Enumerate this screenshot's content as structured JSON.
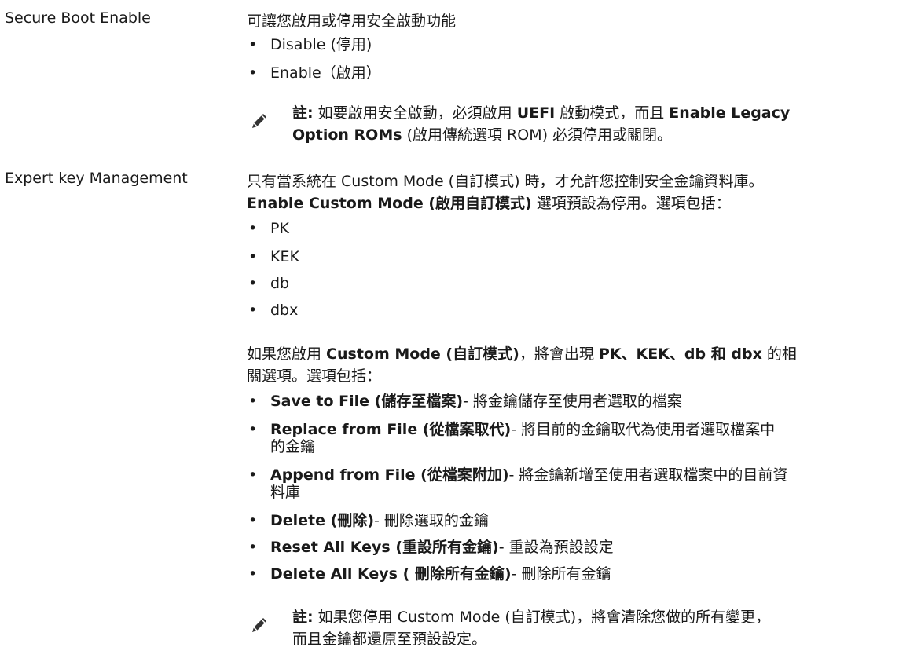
{
  "secure_boot": {
    "label": "Secure Boot Enable",
    "description": "可讓您啟用或停用安全啟動功能",
    "options": [
      "Disable (停用)",
      "Enable（啟用）"
    ],
    "note": {
      "prefix": "註:",
      "t1": " 如要啟用安全啟動，必須啟用 ",
      "b1": "UEFI",
      "t2": " 啟動模式，而且 ",
      "b2": "Enable Legacy",
      "b3": "Option ROMs",
      "t3": " (啟用傳統選項 ROM) 必須停用或關閉。"
    }
  },
  "expert_key": {
    "label": "Expert key Management",
    "desc_line1": "只有當系統在 Custom Mode (自訂模式) 時，才允許您控制安全金鑰資料庫。",
    "desc_line2_bold": "Enable Custom Mode (啟用自訂模式)",
    "desc_line2_rest": " 選項預設為停用。選項包括：",
    "keys": [
      "PK",
      "KEK",
      "db",
      "dbx"
    ],
    "custom_p1": "如果您啟用 ",
    "custom_b1": "Custom Mode (自訂模式)",
    "custom_p2": "，將會出現 ",
    "custom_b2": "PK、KEK、db 和 dbx",
    "custom_p3": " 的相",
    "custom_line2": "關選項。選項包括：",
    "actions": [
      {
        "name": "Save to File (儲存至檔案)",
        "desc": "- 將金鑰儲存至使用者選取的檔案"
      },
      {
        "name": "Replace from File (從檔案取代)",
        "desc": "- 將目前的金鑰取代為使用者選取檔案中",
        "desc2": "的金鑰"
      },
      {
        "name": "Append from File (從檔案附加)",
        "desc": "- 將金鑰新增至使用者選取檔案中的目前資",
        "desc2": "料庫"
      },
      {
        "name": "Delete (刪除)",
        "desc": "- 刪除選取的金鑰"
      },
      {
        "name": "Reset All Keys (重設所有金鑰)",
        "desc": "- 重設為預設設定"
      },
      {
        "name": "Delete All Keys ( 刪除所有金鑰)",
        "desc": "- 刪除所有金鑰"
      }
    ],
    "note": {
      "prefix": "註:",
      "line1": " 如果您停用 Custom Mode (自訂模式)，將會清除您做的所有變更，",
      "line2": "而且金鑰都還原至預設設定。"
    }
  },
  "colors": {
    "text": "#1a1a1a",
    "icon": "#333333"
  },
  "icons": {
    "note": "pencil-note-icon"
  }
}
